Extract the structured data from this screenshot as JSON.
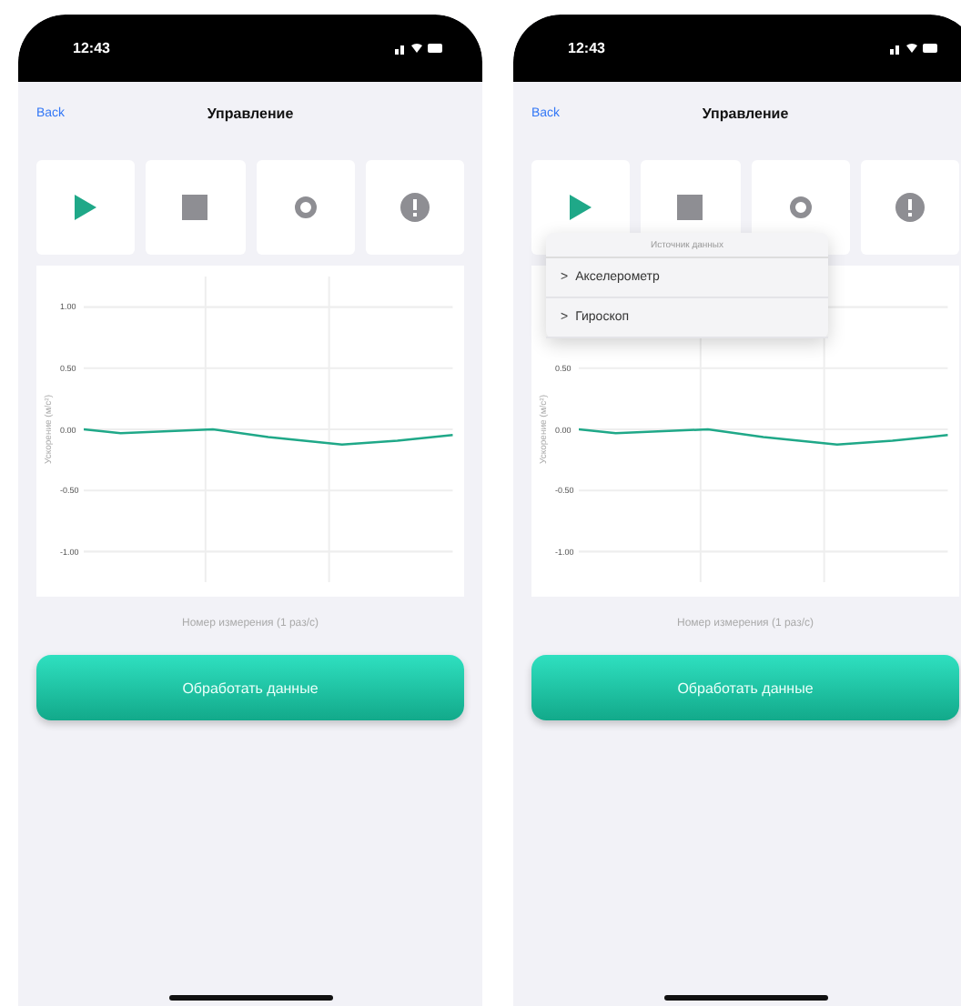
{
  "phones": [
    {
      "status_time": "12:43",
      "nav": {
        "back": "Back",
        "title": "Управление"
      },
      "toolbar": [
        {
          "kind": "play"
        },
        {
          "kind": "stop"
        },
        {
          "kind": "settings"
        },
        {
          "kind": "info"
        }
      ],
      "chart": {
        "ylabel": "Ускорение (м/с²)",
        "yticks": [
          "1.00",
          "0.50",
          "0.00",
          "-0.50",
          "-1.00"
        ],
        "xlabel": "Номер измерения (1 раз/с)"
      },
      "action_button": "Обработать данные"
    },
    {
      "status_time": "12:43",
      "nav": {
        "back": "Back",
        "title": "Управление"
      },
      "toolbar": [
        {
          "kind": "play"
        },
        {
          "kind": "stop"
        },
        {
          "kind": "settings"
        },
        {
          "kind": "info"
        }
      ],
      "chart": {
        "ylabel": "Ускорение (м/с²)",
        "yticks": [
          "0.50",
          "0.00",
          "-0.50",
          "-1.00"
        ],
        "xlabel": "Номер измерения (1 раз/с)"
      },
      "action_button": "Обработать данные",
      "menu": {
        "title": "Источник данных",
        "items": [
          {
            "marker": ">",
            "label": "Акселерометр"
          },
          {
            "marker": ">",
            "label": "Гироскоп"
          }
        ]
      }
    }
  ]
}
